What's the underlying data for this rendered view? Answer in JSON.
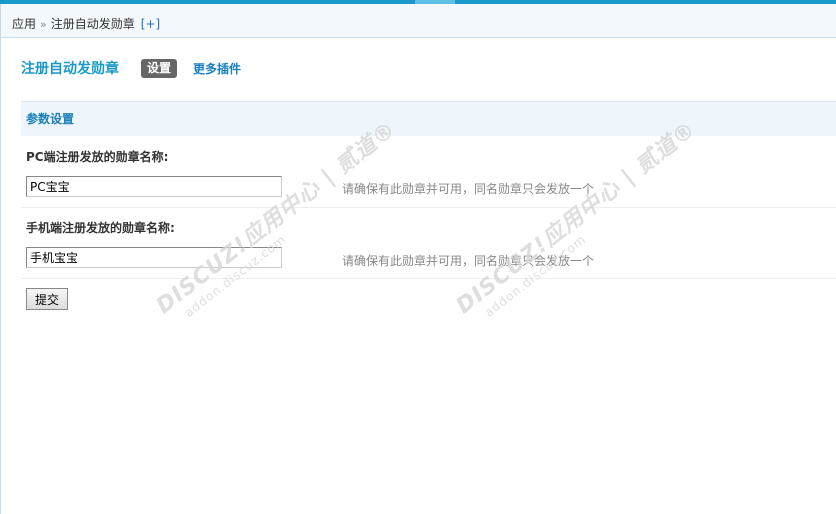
{
  "breadcrumb": {
    "root": "应用",
    "separator": "»",
    "current": "注册自动发勋章",
    "add": "[+]"
  },
  "header": {
    "title": "注册自动发勋章",
    "active_tab": "设置",
    "more_link": "更多插件"
  },
  "section": {
    "title": "参数设置"
  },
  "fields": [
    {
      "label": "PC端注册发放的勋章名称:",
      "value": "PC宝宝",
      "hint": "请确保有此勋章并可用，同名勋章只会发放一个"
    },
    {
      "label": "手机端注册发放的勋章名称:",
      "value": "手机宝宝",
      "hint": "请确保有此勋章并可用，同名勋章只会发放一个"
    }
  ],
  "submit_label": "提交",
  "watermark": {
    "main": "DISCUZ!应用中心 | 贰道®",
    "sub": "addon.discuz.com"
  },
  "colors": {
    "accent": "#1a9ac8",
    "link": "#1a7fc0",
    "section_bg": "#eef6fc",
    "active_tab_bg": "#666666",
    "hint": "#888888"
  }
}
